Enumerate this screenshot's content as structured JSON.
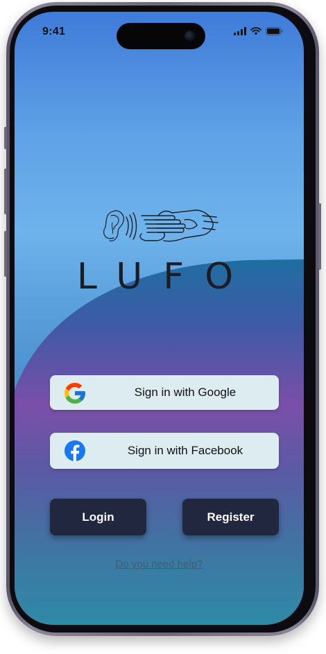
{
  "status_bar": {
    "time": "9:41",
    "icons": [
      "cellular-signal-icon",
      "wifi-icon",
      "battery-icon"
    ]
  },
  "brand": {
    "name": "LUFO",
    "logo_icon": "ear-and-hand-sign-logo"
  },
  "auth": {
    "google": {
      "label": "Sign in with Google",
      "icon": "google-icon"
    },
    "facebook": {
      "label": "Sign in with Facebook",
      "icon": "facebook-icon"
    },
    "login_label": "Login",
    "register_label": "Register",
    "help_label": "Do you need help?"
  },
  "colors": {
    "primary_button": "#222740",
    "social_button_bg": "#dcecf1",
    "purple_accent": "#7a4fa8",
    "sky_blue": "#6fb3ec"
  }
}
